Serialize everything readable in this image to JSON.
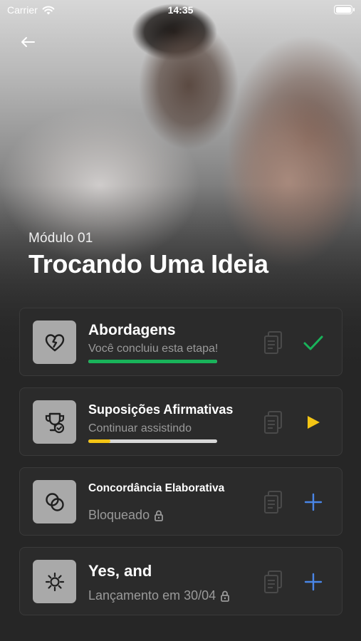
{
  "status_bar": {
    "carrier": "Carrier",
    "time": "14:35"
  },
  "module": {
    "label": "Módulo 01",
    "title": "Trocando Uma Ideia"
  },
  "colors": {
    "success": "#19b35a",
    "play": "#f4c514",
    "plus": "#4a86e8",
    "progress_track": "#d8d8d8"
  },
  "lessons": [
    {
      "title": "Abordagens",
      "subtitle": "Você concluiu esta etapa!",
      "progress": 1.0,
      "icon": "broken-heart-icon",
      "action": "checkmark-icon",
      "locked": false
    },
    {
      "title": "Suposições Afirmativas",
      "subtitle": "Continuar assistindo",
      "progress": 0.17,
      "icon": "trophy-icon",
      "action": "play-icon",
      "locked": false
    },
    {
      "title": "Concordância Elaborativa",
      "subtitle": "Bloqueado",
      "icon": "overlap-circles-icon",
      "action": "plus-icon",
      "locked": true
    },
    {
      "title": "Yes, and",
      "subtitle": "Lançamento em 30/04",
      "icon": "sun-icon",
      "action": "plus-icon",
      "locked": true
    }
  ]
}
